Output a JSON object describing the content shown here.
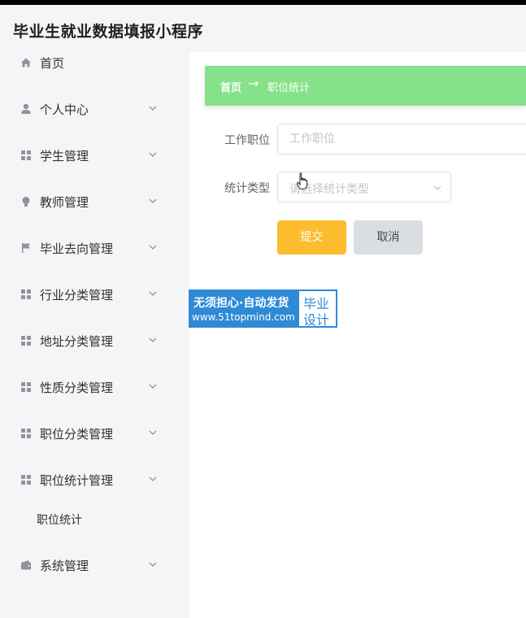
{
  "app": {
    "title": "毕业生就业数据填报小程序"
  },
  "sidebar": {
    "items": [
      {
        "label": "首页",
        "icon": "home-icon",
        "expandable": false
      },
      {
        "label": "个人中心",
        "icon": "user-icon",
        "expandable": true
      },
      {
        "label": "学生管理",
        "icon": "grid-icon",
        "expandable": true
      },
      {
        "label": "教师管理",
        "icon": "bulb-icon",
        "expandable": true
      },
      {
        "label": "毕业去向管理",
        "icon": "flag-icon",
        "expandable": true
      },
      {
        "label": "行业分类管理",
        "icon": "grid-icon",
        "expandable": true
      },
      {
        "label": "地址分类管理",
        "icon": "grid-icon",
        "expandable": true
      },
      {
        "label": "性质分类管理",
        "icon": "grid-icon",
        "expandable": true
      },
      {
        "label": "职位分类管理",
        "icon": "grid-icon",
        "expandable": true
      },
      {
        "label": "职位统计管理",
        "icon": "grid-icon",
        "expandable": true
      },
      {
        "label": "系统管理",
        "icon": "wallet-icon",
        "expandable": true
      }
    ],
    "subitem": {
      "label": "职位统计"
    }
  },
  "breadcrumb": {
    "home": "首页",
    "separator": "→",
    "current": "职位统计"
  },
  "form": {
    "position_label": "工作职位",
    "position_placeholder": "工作职位",
    "type_label": "统计类型",
    "type_placeholder": "请选择统计类型",
    "submit": "提交",
    "cancel": "取消"
  },
  "watermark": {
    "line1": "无须担心·自动发货",
    "line2": "www.51topmind.com",
    "right1": "毕业",
    "right2": "设计"
  },
  "colors": {
    "breadcrumb_bg": "#86e28a",
    "submit_bg": "#fbbd2e",
    "cancel_bg": "#dadde2",
    "watermark_blue": "#2f8ad6"
  }
}
